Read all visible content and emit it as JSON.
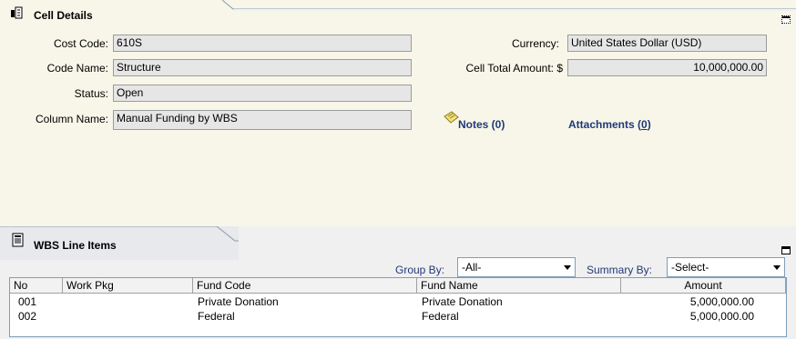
{
  "cell_details": {
    "title": "Cell Details",
    "cost_code_label": "Cost Code:",
    "cost_code_value": "610S",
    "code_name_label": "Code Name:",
    "code_name_value": "Structure",
    "status_label": "Status:",
    "status_value": "Open",
    "column_name_label": "Column Name:",
    "column_name_value": "Manual Funding by WBS",
    "currency_label": "Currency:",
    "currency_value": "United States Dollar (USD)",
    "cell_total_label": "Cell Total Amount: $",
    "cell_total_value": "10,000,000.00",
    "notes_label": "Notes (0)",
    "attachments_label": "Attachments (",
    "attachments_count": "0",
    "attachments_close": ")"
  },
  "wbs": {
    "title": "WBS Line Items",
    "group_by_label": "Group By:",
    "group_by_value": "-All-",
    "summary_by_label": "Summary By:",
    "summary_by_value": "-Select-",
    "columns": [
      "No",
      "Work Pkg",
      "Fund Code",
      "Fund Name",
      "Amount"
    ],
    "rows": [
      {
        "no": "001",
        "work_pkg": "",
        "fund_code": "Private Donation",
        "fund_name": "Private Donation",
        "amount": "5,000,000.00"
      },
      {
        "no": "002",
        "work_pkg": "",
        "fund_code": "Federal",
        "fund_name": "Federal",
        "amount": "5,000,000.00"
      }
    ]
  },
  "colors": {
    "panel_bg": "#f7f6e8",
    "link": "#1f3a7a",
    "field_bg": "#e6e6e6"
  }
}
